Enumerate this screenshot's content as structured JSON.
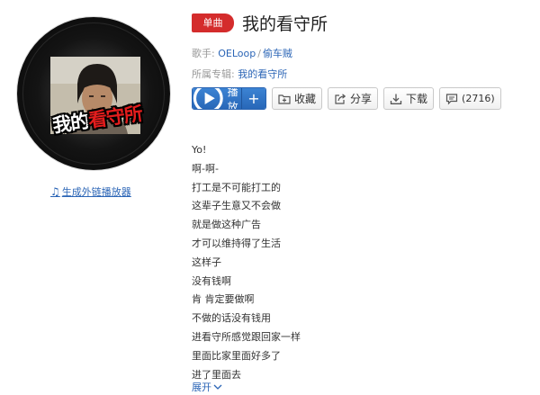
{
  "cover": {
    "text_white": "我的",
    "text_red": "看守所"
  },
  "player_link": {
    "icon": "music-note-icon",
    "label": "生成外链播放器"
  },
  "header": {
    "badge": "单曲",
    "title": "我的看守所"
  },
  "meta": {
    "artist_label": "歌手:",
    "artists": [
      "OELoop",
      "偷车贼"
    ],
    "separator": "/",
    "album_label": "所属专辑:",
    "album": "我的看守所"
  },
  "actions": {
    "play": "播放",
    "add": "+",
    "collect": "收藏",
    "share": "分享",
    "download": "下载",
    "comments": "(2716)"
  },
  "colors": {
    "badge": "#d42c2c",
    "play_button": "#2f74c6",
    "link": "#2b65b6"
  },
  "lyrics": [
    "Yo!",
    "啊-啊-",
    "打工是不可能打工的",
    "这辈子生意又不会做",
    "就是做这种广告",
    "才可以维持得了生活",
    "这样子",
    "没有钱啊",
    "肯 肯定要做啊",
    "不做的话没有钱用",
    "进看守所感觉跟回家一样",
    "里面比家里面好多了",
    "进了里面去"
  ],
  "expand_label": "展开"
}
